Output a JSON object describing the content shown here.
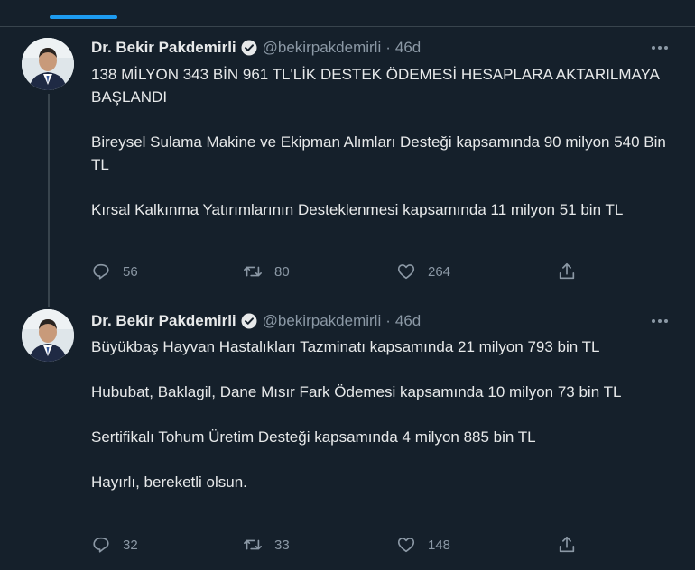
{
  "tweets": [
    {
      "author": "Dr. Bekir Pakdemirli",
      "handle": "@bekirpakdemirli",
      "separator": "·",
      "time": "46d",
      "paragraphs": [
        "138 MİLYON 343 BİN 961 TL'LİK DESTEK ÖDEMESİ HESAPLARA AKTARILMAYA BAŞLANDI",
        "Bireysel Sulama Makine ve Ekipman Alımları Desteği kapsamında 90 milyon 540 Bin TL",
        "Kırsal Kalkınma Yatırımlarının Desteklenmesi kapsamında 11 milyon 51 bin TL"
      ],
      "replies": "56",
      "retweets": "80",
      "likes": "264"
    },
    {
      "author": "Dr. Bekir Pakdemirli",
      "handle": "@bekirpakdemirli",
      "separator": "·",
      "time": "46d",
      "paragraphs": [
        "Büyükbaş Hayvan Hastalıkları Tazminatı kapsamında 21 milyon 793 bin TL",
        "Hububat, Baklagil, Dane Mısır Fark Ödemesi kapsamında 10 milyon 73 bin TL",
        "Sertifikalı Tohum Üretim Desteği kapsamında 4 milyon 885 bin TL",
        "Hayırlı, bereketli olsun."
      ],
      "replies": "32",
      "retweets": "33",
      "likes": "148"
    }
  ],
  "colors": {
    "background": "#15202b",
    "text": "#e7e9ea",
    "muted": "#8b98a5",
    "accent": "#1d9bf0",
    "divider": "#38444d"
  },
  "icons": [
    "verified-badge-icon",
    "more-icon",
    "reply-icon",
    "retweet-icon",
    "like-icon",
    "share-icon"
  ]
}
